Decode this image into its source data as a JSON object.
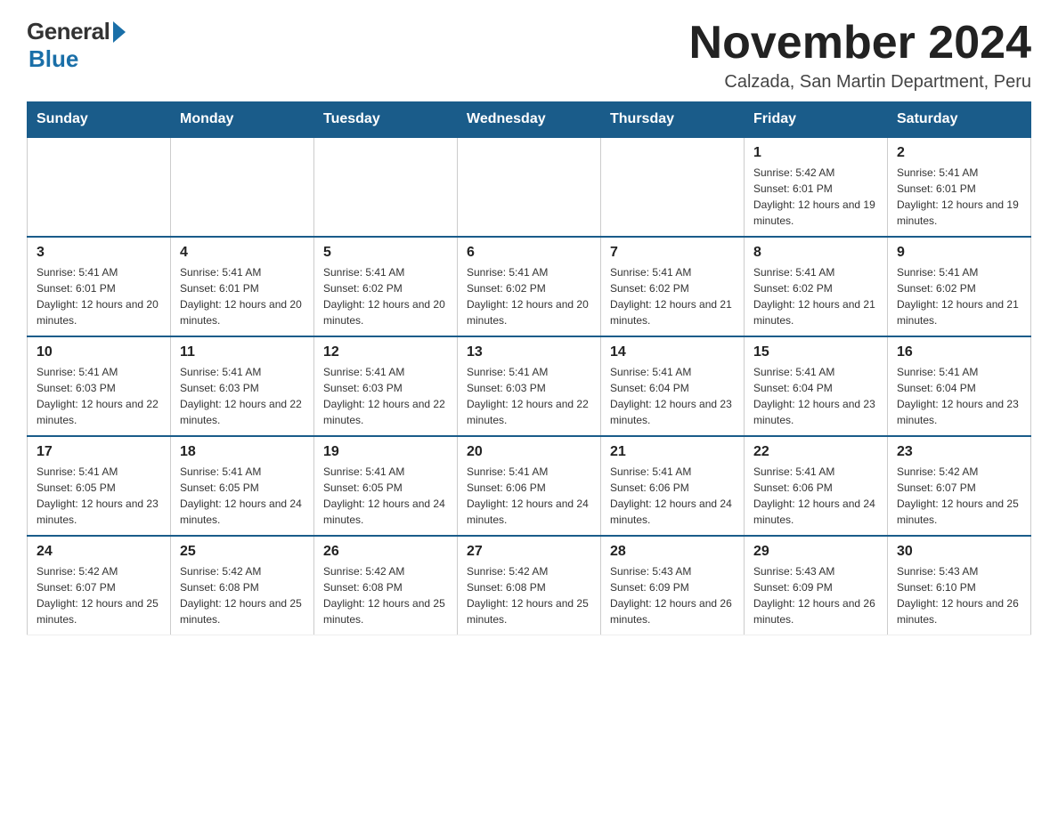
{
  "logo": {
    "general_text": "General",
    "blue_text": "Blue"
  },
  "title": "November 2024",
  "subtitle": "Calzada, San Martin Department, Peru",
  "headers": [
    "Sunday",
    "Monday",
    "Tuesday",
    "Wednesday",
    "Thursday",
    "Friday",
    "Saturday"
  ],
  "weeks": [
    [
      {
        "day": "",
        "sunrise": "",
        "sunset": "",
        "daylight": ""
      },
      {
        "day": "",
        "sunrise": "",
        "sunset": "",
        "daylight": ""
      },
      {
        "day": "",
        "sunrise": "",
        "sunset": "",
        "daylight": ""
      },
      {
        "day": "",
        "sunrise": "",
        "sunset": "",
        "daylight": ""
      },
      {
        "day": "",
        "sunrise": "",
        "sunset": "",
        "daylight": ""
      },
      {
        "day": "1",
        "sunrise": "Sunrise: 5:42 AM",
        "sunset": "Sunset: 6:01 PM",
        "daylight": "Daylight: 12 hours and 19 minutes."
      },
      {
        "day": "2",
        "sunrise": "Sunrise: 5:41 AM",
        "sunset": "Sunset: 6:01 PM",
        "daylight": "Daylight: 12 hours and 19 minutes."
      }
    ],
    [
      {
        "day": "3",
        "sunrise": "Sunrise: 5:41 AM",
        "sunset": "Sunset: 6:01 PM",
        "daylight": "Daylight: 12 hours and 20 minutes."
      },
      {
        "day": "4",
        "sunrise": "Sunrise: 5:41 AM",
        "sunset": "Sunset: 6:01 PM",
        "daylight": "Daylight: 12 hours and 20 minutes."
      },
      {
        "day": "5",
        "sunrise": "Sunrise: 5:41 AM",
        "sunset": "Sunset: 6:02 PM",
        "daylight": "Daylight: 12 hours and 20 minutes."
      },
      {
        "day": "6",
        "sunrise": "Sunrise: 5:41 AM",
        "sunset": "Sunset: 6:02 PM",
        "daylight": "Daylight: 12 hours and 20 minutes."
      },
      {
        "day": "7",
        "sunrise": "Sunrise: 5:41 AM",
        "sunset": "Sunset: 6:02 PM",
        "daylight": "Daylight: 12 hours and 21 minutes."
      },
      {
        "day": "8",
        "sunrise": "Sunrise: 5:41 AM",
        "sunset": "Sunset: 6:02 PM",
        "daylight": "Daylight: 12 hours and 21 minutes."
      },
      {
        "day": "9",
        "sunrise": "Sunrise: 5:41 AM",
        "sunset": "Sunset: 6:02 PM",
        "daylight": "Daylight: 12 hours and 21 minutes."
      }
    ],
    [
      {
        "day": "10",
        "sunrise": "Sunrise: 5:41 AM",
        "sunset": "Sunset: 6:03 PM",
        "daylight": "Daylight: 12 hours and 22 minutes."
      },
      {
        "day": "11",
        "sunrise": "Sunrise: 5:41 AM",
        "sunset": "Sunset: 6:03 PM",
        "daylight": "Daylight: 12 hours and 22 minutes."
      },
      {
        "day": "12",
        "sunrise": "Sunrise: 5:41 AM",
        "sunset": "Sunset: 6:03 PM",
        "daylight": "Daylight: 12 hours and 22 minutes."
      },
      {
        "day": "13",
        "sunrise": "Sunrise: 5:41 AM",
        "sunset": "Sunset: 6:03 PM",
        "daylight": "Daylight: 12 hours and 22 minutes."
      },
      {
        "day": "14",
        "sunrise": "Sunrise: 5:41 AM",
        "sunset": "Sunset: 6:04 PM",
        "daylight": "Daylight: 12 hours and 23 minutes."
      },
      {
        "day": "15",
        "sunrise": "Sunrise: 5:41 AM",
        "sunset": "Sunset: 6:04 PM",
        "daylight": "Daylight: 12 hours and 23 minutes."
      },
      {
        "day": "16",
        "sunrise": "Sunrise: 5:41 AM",
        "sunset": "Sunset: 6:04 PM",
        "daylight": "Daylight: 12 hours and 23 minutes."
      }
    ],
    [
      {
        "day": "17",
        "sunrise": "Sunrise: 5:41 AM",
        "sunset": "Sunset: 6:05 PM",
        "daylight": "Daylight: 12 hours and 23 minutes."
      },
      {
        "day": "18",
        "sunrise": "Sunrise: 5:41 AM",
        "sunset": "Sunset: 6:05 PM",
        "daylight": "Daylight: 12 hours and 24 minutes."
      },
      {
        "day": "19",
        "sunrise": "Sunrise: 5:41 AM",
        "sunset": "Sunset: 6:05 PM",
        "daylight": "Daylight: 12 hours and 24 minutes."
      },
      {
        "day": "20",
        "sunrise": "Sunrise: 5:41 AM",
        "sunset": "Sunset: 6:06 PM",
        "daylight": "Daylight: 12 hours and 24 minutes."
      },
      {
        "day": "21",
        "sunrise": "Sunrise: 5:41 AM",
        "sunset": "Sunset: 6:06 PM",
        "daylight": "Daylight: 12 hours and 24 minutes."
      },
      {
        "day": "22",
        "sunrise": "Sunrise: 5:41 AM",
        "sunset": "Sunset: 6:06 PM",
        "daylight": "Daylight: 12 hours and 24 minutes."
      },
      {
        "day": "23",
        "sunrise": "Sunrise: 5:42 AM",
        "sunset": "Sunset: 6:07 PM",
        "daylight": "Daylight: 12 hours and 25 minutes."
      }
    ],
    [
      {
        "day": "24",
        "sunrise": "Sunrise: 5:42 AM",
        "sunset": "Sunset: 6:07 PM",
        "daylight": "Daylight: 12 hours and 25 minutes."
      },
      {
        "day": "25",
        "sunrise": "Sunrise: 5:42 AM",
        "sunset": "Sunset: 6:08 PM",
        "daylight": "Daylight: 12 hours and 25 minutes."
      },
      {
        "day": "26",
        "sunrise": "Sunrise: 5:42 AM",
        "sunset": "Sunset: 6:08 PM",
        "daylight": "Daylight: 12 hours and 25 minutes."
      },
      {
        "day": "27",
        "sunrise": "Sunrise: 5:42 AM",
        "sunset": "Sunset: 6:08 PM",
        "daylight": "Daylight: 12 hours and 25 minutes."
      },
      {
        "day": "28",
        "sunrise": "Sunrise: 5:43 AM",
        "sunset": "Sunset: 6:09 PM",
        "daylight": "Daylight: 12 hours and 26 minutes."
      },
      {
        "day": "29",
        "sunrise": "Sunrise: 5:43 AM",
        "sunset": "Sunset: 6:09 PM",
        "daylight": "Daylight: 12 hours and 26 minutes."
      },
      {
        "day": "30",
        "sunrise": "Sunrise: 5:43 AM",
        "sunset": "Sunset: 6:10 PM",
        "daylight": "Daylight: 12 hours and 26 minutes."
      }
    ]
  ]
}
